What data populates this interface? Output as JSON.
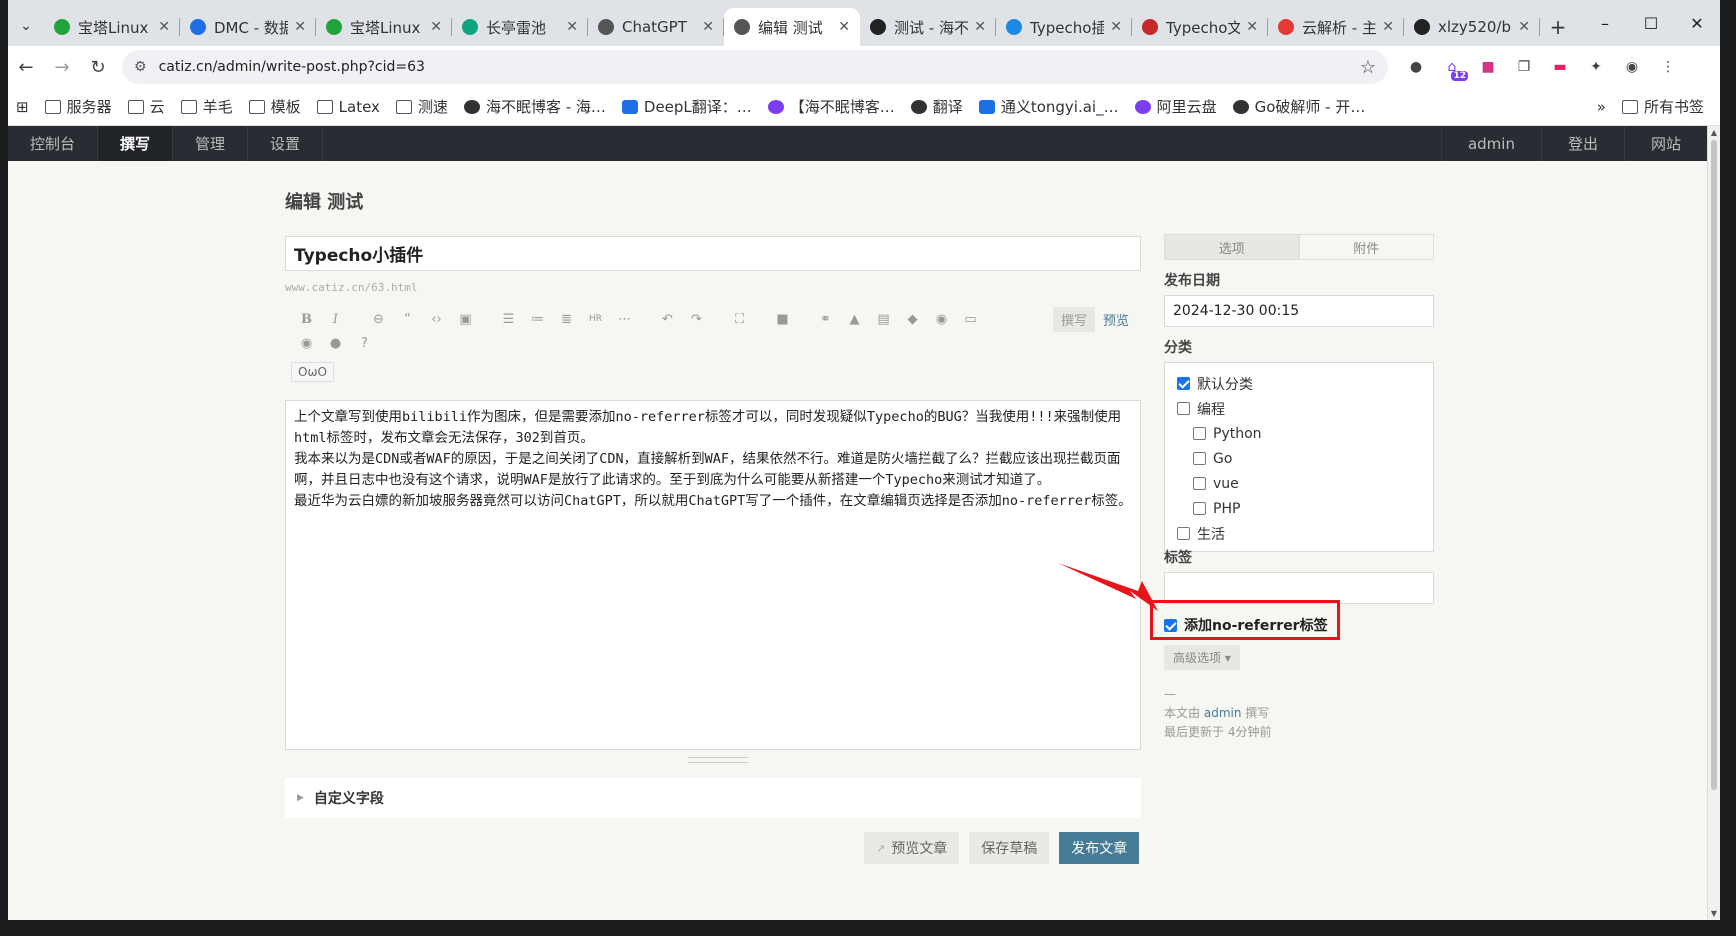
{
  "browser": {
    "tabs": [
      {
        "title": "宝塔Linux",
        "icon": "baota-icon",
        "color": "#20a53a"
      },
      {
        "title": "DMC - 数据",
        "icon": "dmc-icon",
        "color": "#1e6fe6"
      },
      {
        "title": "宝塔Linux",
        "icon": "baota-icon",
        "color": "#20a53a"
      },
      {
        "title": "长亭雷池",
        "icon": "leichi-icon",
        "color": "#10a37f"
      },
      {
        "title": "ChatGPT",
        "icon": "chatgpt-icon",
        "color": "#555555"
      },
      {
        "title": "编辑 测试",
        "icon": "typecho-icon",
        "color": "#555555",
        "active": true
      },
      {
        "title": "测试 - 海不",
        "icon": "blog-icon",
        "color": "#222222"
      },
      {
        "title": "Typecho插",
        "icon": "cloud-icon",
        "color": "#1e88e5"
      },
      {
        "title": "Typecho文",
        "icon": "typecho-icon",
        "color": "#c62828"
      },
      {
        "title": "云解析 - 主",
        "icon": "huawei-icon",
        "color": "#e53935"
      },
      {
        "title": "xlzy520/b",
        "icon": "github-icon",
        "color": "#222222"
      }
    ],
    "new_tab": "+",
    "url": "catiz.cn/admin/write-post.php?cid=63",
    "bookmarks": [
      {
        "label": "服务器",
        "type": "folder"
      },
      {
        "label": "云",
        "type": "folder"
      },
      {
        "label": "羊毛",
        "type": "folder"
      },
      {
        "label": "模板",
        "type": "folder"
      },
      {
        "label": "Latex",
        "type": "folder"
      },
      {
        "label": "测速",
        "type": "folder"
      },
      {
        "label": "海不眠博客 - 海…",
        "type": "site"
      },
      {
        "label": "DeepL翻译：…",
        "type": "site"
      },
      {
        "label": "【海不眠博客…",
        "type": "site"
      },
      {
        "label": "翻译",
        "type": "site"
      },
      {
        "label": "通义tongyi.ai_…",
        "type": "site"
      },
      {
        "label": "阿里云盘",
        "type": "site"
      },
      {
        "label": "Go破解师 - 开…",
        "type": "site"
      }
    ],
    "bookmarks_more": "»",
    "all_bookmarks": "所有书签",
    "extension_badge": "12"
  },
  "admin_nav": {
    "left": [
      "控制台",
      "撰写",
      "管理",
      "设置"
    ],
    "active": "撰写",
    "right": [
      "admin",
      "登出",
      "网站"
    ]
  },
  "editor": {
    "heading": "编辑 测试",
    "post_title": "Typecho小插件",
    "slug_url": "www.catiz.cn/63.html",
    "mode_write": "撰写",
    "mode_preview": "预览",
    "owo": "OωO",
    "content": [
      "上个文章写到使用bilibili作为图床，但是需要添加no-referrer标签才可以，同时发现疑似Typecho的BUG？当我使用!!!来强制使用html标签时，发布文章会无法保存，302到首页。",
      "我本来以为是CDN或者WAF的原因，于是之间关闭了CDN，直接解析到WAF，结果依然不行。难道是防火墙拦截了么？拦截应该出现拦截页面啊，并且日志中也没有这个请求，说明WAF是放行了此请求的。至于到底为什么可能要从新搭建一个Typecho来测试才知道了。",
      "最近华为云白嫖的新加坡服务器竟然可以访问ChatGPT，所以就用ChatGPT写了一个插件，在文章编辑页选择是否添加no-referrer标签。"
    ],
    "custom_fields": "自定义字段",
    "btn_preview": "预览文章",
    "btn_draft": "保存草稿",
    "btn_publish": "发布文章"
  },
  "sidebar": {
    "tab_options": "选项",
    "tab_attachments": "附件",
    "date_label": "发布日期",
    "date_value": "2024-12-30 00:15",
    "category_label": "分类",
    "categories": [
      {
        "name": "默认分类",
        "checked": true,
        "sub": false
      },
      {
        "name": "编程",
        "checked": false,
        "sub": false
      },
      {
        "name": "Python",
        "checked": false,
        "sub": true
      },
      {
        "name": "Go",
        "checked": false,
        "sub": true
      },
      {
        "name": "vue",
        "checked": false,
        "sub": true
      },
      {
        "name": "PHP",
        "checked": false,
        "sub": true
      },
      {
        "name": "生活",
        "checked": false,
        "sub": false
      }
    ],
    "tags_label": "标签",
    "noreferrer_label": "添加no-referrer标签",
    "noreferrer_checked": true,
    "advanced": "高级选项",
    "meta_dash": "—",
    "meta_author_prefix": "本文由",
    "meta_author": "admin",
    "meta_author_suffix": "撰写",
    "meta_updated": "最后更新于 4分钟前"
  },
  "accent_colors": {
    "annotation": "#e8141c",
    "primary": "#467b96"
  }
}
